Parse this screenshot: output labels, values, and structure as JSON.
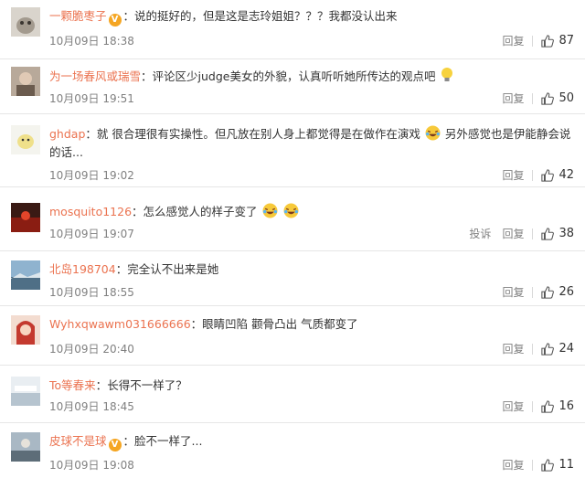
{
  "comments": [
    {
      "user": "一颗脆枣子",
      "vip": true,
      "sep": "：",
      "text": "说的挺好的，但是这是志玲姐姐？？？我都没认出来",
      "time": "10月09日 18:38",
      "reply": "回复",
      "likes": "87"
    },
    {
      "user": "为一场春风或瑞雪",
      "vip": false,
      "sep": "：",
      "text": "评论区少judge美女的外貌，认真听听她所传达的观点吧",
      "time": "10月09日 19:51",
      "reply": "回复",
      "likes": "50"
    },
    {
      "user": "ghdap",
      "vip": false,
      "sep": "：",
      "text_a": "就 很合理很有实操性。但凡放在别人身上都觉得是在做作在演戏",
      "text_b": "另外感觉也是伊能静会说的话...",
      "time": "10月09日 19:02",
      "reply": "回复",
      "likes": "42"
    },
    {
      "user": "mosquito1126",
      "vip": false,
      "sep": "：",
      "text": "怎么感觉人的样子变了",
      "time": "10月09日 19:07",
      "report": "投诉",
      "reply": "回复",
      "likes": "38"
    },
    {
      "user": "北岛198704",
      "vip": false,
      "sep": "：",
      "text": "完全认不出来是她",
      "time": "10月09日 18:55",
      "reply": "回复",
      "likes": "26"
    },
    {
      "user": "Wyhxqwawm031666666",
      "vip": false,
      "sep": "：",
      "text": "眼睛凹陷 颧骨凸出 气质都变了",
      "time": "10月09日 20:40",
      "reply": "回复",
      "likes": "24"
    },
    {
      "user": "To等春来",
      "vip": false,
      "sep": "：",
      "text": "长得不一样了？",
      "time": "10月09日 18:45",
      "reply": "回复",
      "likes": "16"
    },
    {
      "user": "皮球不是球",
      "vip": true,
      "sep": "：",
      "text": "脸不一样了...",
      "time": "10月09日 19:08",
      "reply": "回复",
      "likes": "11"
    }
  ],
  "colors": {
    "username": "#eb7350",
    "vip_badge": "#f5a623"
  },
  "icons": {
    "like": "thumbs-up-icon",
    "vip": "vip-badge-icon",
    "emoji_laugh": "laugh-cry-emoji-icon",
    "emoji_bulb": "lightbulb-emoji-icon"
  }
}
